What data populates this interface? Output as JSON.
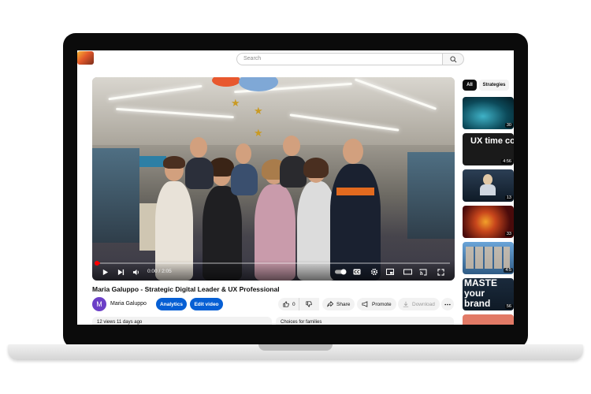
{
  "header": {
    "search_placeholder": "Search"
  },
  "player": {
    "time": "0:00 / 2:05",
    "progress_fraction": 0.01
  },
  "video": {
    "title": "Maria Galuppo - Strategic Digital Leader & UX Professional",
    "channel_initial": "M",
    "channel_name": "Maria Galuppo",
    "analytics_label": "Analytics",
    "edit_label": "Edit video",
    "like_count": "0",
    "share_label": "Share",
    "promote_label": "Promote",
    "download_label": "Download",
    "stats": "12 views  11 days ago",
    "comments_hint": "Choices for families"
  },
  "sidebar": {
    "chips": [
      "All",
      "Strategies"
    ],
    "thumbs": [
      {
        "duration": "30",
        "text": ""
      },
      {
        "duration": "4:56",
        "text": "UX time conference"
      },
      {
        "duration": "13",
        "text": ""
      },
      {
        "duration": "33",
        "text": ""
      },
      {
        "duration": "4:5",
        "text": ""
      },
      {
        "duration": "56",
        "text": "MASTE your brand"
      }
    ]
  },
  "colors": {
    "accent_blue": "#065fd4",
    "progress_red": "#ff0000",
    "avatar_purple": "#6b3fc7"
  }
}
